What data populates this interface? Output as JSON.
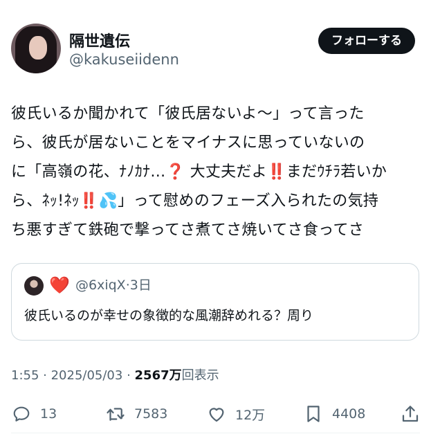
{
  "author": {
    "display_name": "隔世遺伝",
    "handle": "@kakuseiidenn"
  },
  "follow_button": {
    "label": "フォローする"
  },
  "tweet": {
    "text": "彼氏いるか聞かれて「彼氏居ないよ〜」って言った\nら、彼氏が居ないことをマイナスに思っていないの\nに「高嶺の花、ﾅﾉｶﾅ…❓ 大丈夫だよ‼️まだｳﾁﾗ若いか\nら、ﾈｯ!ﾈｯ‼️💦」って慰めのフェーズ入られたの気持\nち悪すぎて鉄砲で撃ってさ煮てさ焼いてさ食ってさ"
  },
  "quote": {
    "heart": "❤️",
    "handle": "@6xiqX",
    "separator": "·",
    "time": "3日",
    "text": "彼氏いるのが幸せの象徴的な風潮辞めれる？周り"
  },
  "meta": {
    "time": "1:55",
    "sep1": " · ",
    "date": "2025/05/03",
    "sep2": " · ",
    "views_count": "2567万",
    "views_label": "回表示"
  },
  "actions": {
    "reply_count": "13",
    "retweet_count": "7583",
    "like_count": "12万",
    "bookmark_count": "4408"
  },
  "icons": {
    "reply": "reply-icon",
    "retweet": "retweet-icon",
    "like": "heart-icon",
    "bookmark": "bookmark-icon",
    "share": "share-icon"
  }
}
